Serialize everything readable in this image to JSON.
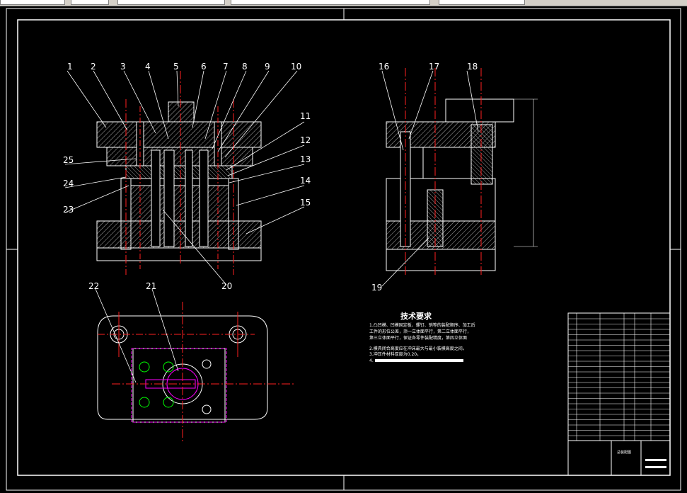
{
  "app": {
    "toolbar": {
      "boxes": [
        "",
        "",
        "",
        "",
        ""
      ]
    }
  },
  "drawing": {
    "part_numbers": [
      "1",
      "2",
      "3",
      "4",
      "5",
      "6",
      "7",
      "8",
      "9",
      "10",
      "11",
      "12",
      "13",
      "14",
      "15",
      "16",
      "17",
      "18",
      "19",
      "20",
      "21",
      "22",
      "23",
      "24",
      "25"
    ],
    "tech_requirements": {
      "title": "技术要求",
      "lines": [
        "1.凸凹模、凹模固定板、螺钉、销等的装配顺序、加工后",
        "工件的形位公差，须一立体面平行，第二立体面平行，",
        "第三立体面平行，保证各零件装配精度，第四立体面",
        "2.模具闭合高度应在冲床最大与最小装模高度之间。",
        "3.冲压件材料厚度为0.20。",
        "4."
      ]
    },
    "title_block": {
      "drawing_name": "总装配图"
    }
  },
  "colors": {
    "background": "#000000",
    "line": "#ffffff",
    "center": "#ff0000",
    "hatch": "#ffffff",
    "magenta": "#ff00ff",
    "green": "#00ff00",
    "chrome": "#d4d0c8"
  }
}
